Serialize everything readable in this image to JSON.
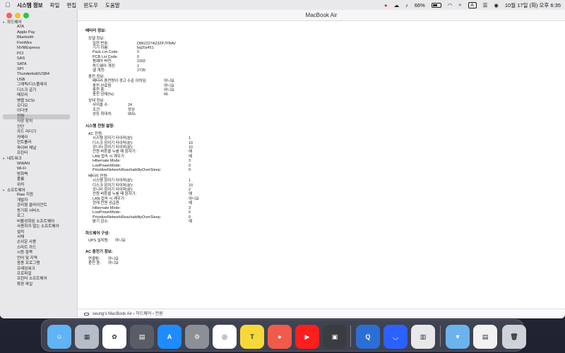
{
  "menubar": {
    "items": [
      "시스템 정보",
      "파일",
      "편집",
      "윈도우",
      "도움말"
    ],
    "battery_percent": "66%",
    "status_a": "A",
    "clock": "10월 17일 (화) 오후 6:35"
  },
  "window": {
    "title": "MacBook Air"
  },
  "sidebar": {
    "groups": [
      {
        "label": "하드웨어",
        "children": [
          "ATA",
          "Apple Pay",
          "Bluetooth",
          "FireWire",
          "NVMExpress",
          "PCI",
          "SAS",
          "SATA",
          "SPI",
          "Thunderbolt/USB4",
          "USB",
          "그래픽/디스플레이",
          "디스크 굽기",
          "메모리",
          "병렬 SCSI",
          "오디오",
          "이더넷",
          "전원",
          "저장 장치",
          "진단",
          "카드 리더기",
          "카메라",
          "컨트롤러",
          "파이버 채널",
          "프린터"
        ]
      },
      {
        "label": "네트워크",
        "children": [
          "WWAN",
          "Wi-Fi",
          "방화벽",
          "볼륨",
          "위치"
        ]
      },
      {
        "label": "소프트웨어",
        "children": [
          "Raw 지원",
          "개발자",
          "관리형 클라이언트",
          "동기화 서비스",
          "로그",
          "비활성화된 소프트웨어",
          "사용하지 않는 소프트웨어",
          "설치",
          "서체",
          "손쉬운 사용",
          "스마트 카드",
          "시동 항목",
          "언어 및 지역",
          "응용 프로그램",
          "프레임워크",
          "프로파일",
          "프린터 소프트웨어",
          "확장 파일"
        ]
      }
    ],
    "selected": "전원"
  },
  "content": {
    "battery_title": "배터리 정보:",
    "model_title": "모델 정보:",
    "model": [
      {
        "k": "일련 번호:",
        "v": "D862227A232PJYRAV"
      },
      {
        "k": "기기 이름:",
        "v": "bq20z451"
      },
      {
        "k": "Pack Lot Code:",
        "v": "0"
      },
      {
        "k": "PCB Lot Code:",
        "v": "0"
      },
      {
        "k": "펌웨어 버전:",
        "v": "1002"
      },
      {
        "k": "하드웨어 개정:",
        "v": "1"
      },
      {
        "k": "셀 개정:",
        "v": "2735"
      }
    ],
    "charge_title": "충전 정보:",
    "charge": [
      {
        "k": "배터리 충전량이 경고 수준 이하임:",
        "v": "아니요"
      },
      {
        "k": "충전 완료됨:",
        "v": "아니요"
      },
      {
        "k": "충전 중:",
        "v": "아니요"
      },
      {
        "k": "충전 상태(%):",
        "v": "66"
      }
    ],
    "health_title": "상태 정보:",
    "health": [
      {
        "k": "사이클 수:",
        "v": "24"
      },
      {
        "k": "조건:",
        "v": "정상"
      },
      {
        "k": "성능 최대치:",
        "v": "95%"
      }
    ],
    "power_title": "시스템 전원 설정:",
    "ac_title": "AC 전원:",
    "ac": [
      {
        "k": "시스템 잠자기 타이머(분):",
        "v": "1"
      },
      {
        "k": "디스크 잠자기 타이머(분):",
        "v": "10"
      },
      {
        "k": "모니터 잠자기 타이머(분):",
        "v": "10"
      },
      {
        "k": "전원 버튼을 누를 때 잠자기:",
        "v": "예"
      },
      {
        "k": "LAN 접속 시 깨우기:",
        "v": "예"
      },
      {
        "k": "Hibernate Mode:",
        "v": "3"
      },
      {
        "k": "LowPowerMode:",
        "v": "0"
      },
      {
        "k": "PrioritizeNetworkReachabilityOverSleep:",
        "v": "0"
      }
    ],
    "batt_power_title": "배터리 전원:",
    "batt_power": [
      {
        "k": "시스템 잠자기 타이머(분):",
        "v": "1"
      },
      {
        "k": "디스크 잠자기 타이머(분):",
        "v": "10"
      },
      {
        "k": "모니터 잠자기 타이머(분):",
        "v": "2"
      },
      {
        "k": "전원 버튼을 누를 때 잠자기:",
        "v": "예"
      },
      {
        "k": "LAN 접속 시 깨우기:",
        "v": "아니요"
      },
      {
        "k": "현재 전원 공급원:",
        "v": "예"
      },
      {
        "k": "Hibernate Mode:",
        "v": "3"
      },
      {
        "k": "LowPowerMode:",
        "v": "0"
      },
      {
        "k": "PrioritizeNetworkReachabilityOverSleep:",
        "v": "0"
      },
      {
        "k": "밝기 감소:",
        "v": "예"
      }
    ],
    "hw_title": "하드웨어 구성:",
    "hw": [
      {
        "k": "UPS 설치됨:",
        "v": "아니요"
      }
    ],
    "charger_title": "AC 충전기 정보:",
    "charger": [
      {
        "k": "연결됨:",
        "v": "아니요"
      },
      {
        "k": "충전 중:",
        "v": "아니요"
      }
    ]
  },
  "statusbar": {
    "path": "seung's MacBook Air › 하드웨어 › 전원"
  },
  "dock": {
    "apps": [
      "Finder",
      "Launchpad",
      "Photos",
      "Calculator",
      "App Store",
      "System Settings",
      "Chrome",
      "KakaoTalk",
      "Screen Recorder",
      "YouTube",
      "Photo Booth",
      "QuickTime",
      "Toss",
      "Archive",
      "Downloads",
      "Preview",
      "Trash"
    ]
  }
}
